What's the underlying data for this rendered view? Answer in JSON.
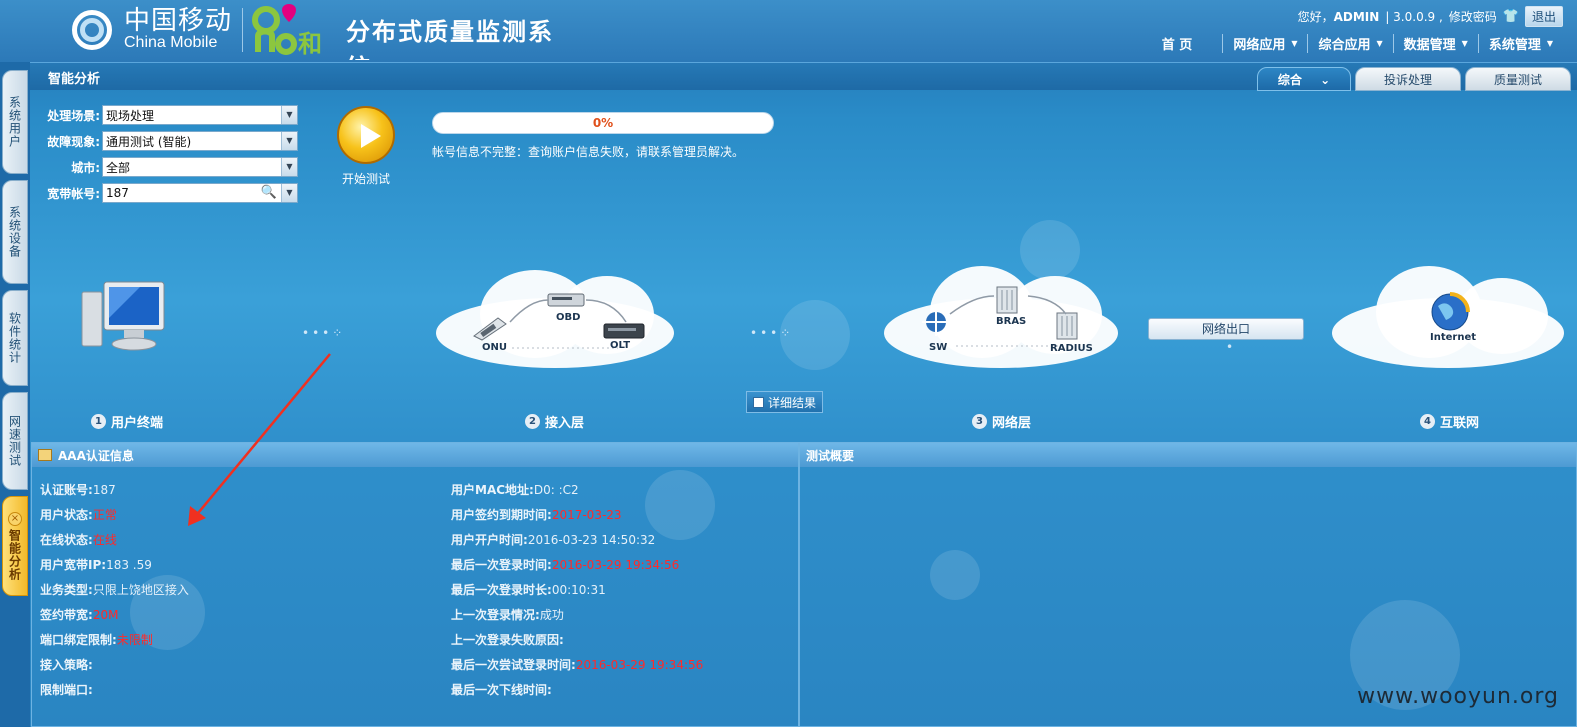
{
  "header": {
    "logo_cn": "中国移动",
    "logo_en": "China Mobile",
    "system_title": "分布式质量监测系统",
    "greeting": "您好，",
    "user": "ADMIN",
    "version": "| 3.0.0.9 ,",
    "change_password": "修改密码",
    "logout": "退出",
    "nav": [
      {
        "label": "首 页",
        "has_menu": false
      },
      {
        "label": "网络应用",
        "has_menu": true
      },
      {
        "label": "综合应用",
        "has_menu": true
      },
      {
        "label": "数据管理",
        "has_menu": true
      },
      {
        "label": "系统管理",
        "has_menu": true
      }
    ]
  },
  "page_title": "智能分析",
  "tabs": [
    {
      "label": "综合",
      "active": true
    },
    {
      "label": "投诉处理",
      "active": false
    },
    {
      "label": "质量测试",
      "active": false
    }
  ],
  "side_tabs": [
    {
      "label": "系统用户",
      "active": false
    },
    {
      "label": "系统设备",
      "active": false
    },
    {
      "label": "软件统计",
      "active": false
    },
    {
      "label": "网速测试",
      "active": false
    },
    {
      "label": "智能分析",
      "active": true
    }
  ],
  "form": {
    "scene_label": "处理场景:",
    "scene_value": "现场处理",
    "fault_label": "故障现象:",
    "fault_value": "通用测试 (智能)",
    "city_label": "城市:",
    "city_value": "全部",
    "account_label": "宽带帐号:",
    "account_value": "187"
  },
  "start_button": "开始测试",
  "progress": {
    "percent": 0,
    "label": "0%"
  },
  "status_message": "帐号信息不完整：查询账户信息失败，请联系管理员解决。",
  "topology": {
    "devices": {
      "onu": "ONU",
      "obd": "OBD",
      "olt": "OLT",
      "sw": "SW",
      "bras": "BRAS",
      "radius": "RADIUS",
      "internet": "Internet"
    },
    "net_exit": "网络出口",
    "detail_button": "详细结果",
    "layers": [
      {
        "num": "1",
        "label": "用户终端"
      },
      {
        "num": "2",
        "label": "接入层"
      },
      {
        "num": "3",
        "label": "网络层"
      },
      {
        "num": "4",
        "label": "互联网"
      }
    ]
  },
  "aaa_panel": {
    "title": "AAA认证信息",
    "left": [
      {
        "k": "认证账号:",
        "v": "187",
        "red": false
      },
      {
        "k": "用户状态:",
        "v": "正常",
        "red": true
      },
      {
        "k": "在线状态:",
        "v": "在线",
        "red": true
      },
      {
        "k": "用户宽带IP:",
        "v": "183          .59",
        "red": false
      },
      {
        "k": "业务类型:",
        "v": "只限上饶地区接入",
        "red": false
      },
      {
        "k": "签约带宽:",
        "v": "20M",
        "red": true
      },
      {
        "k": "端口绑定限制:",
        "v": "未限制",
        "red": true
      },
      {
        "k": "接入策略:",
        "v": "",
        "red": false
      },
      {
        "k": "限制端口:",
        "v": "",
        "red": false
      }
    ],
    "right": [
      {
        "k": "用户MAC地址:",
        "v": "D0:       :C2",
        "red": false
      },
      {
        "k": "用户签约到期时间:",
        "v": "2017-03-23",
        "red": true
      },
      {
        "k": "用户开户时间:",
        "v": "2016-03-23 14:50:32",
        "red": false
      },
      {
        "k": "最后一次登录时间:",
        "v": "2016-03-29 19:34:56",
        "red": true
      },
      {
        "k": "最后一次登录时长:",
        "v": "00:10:31",
        "red": false
      },
      {
        "k": "上一次登录情况:",
        "v": "成功",
        "red": false
      },
      {
        "k": "上一次登录失败原因:",
        "v": "",
        "red": false
      },
      {
        "k": "最后一次尝试登录时间:",
        "v": "2016-03-29 19:34:56",
        "red": true
      },
      {
        "k": "最后一次下线时间:",
        "v": "",
        "red": false
      }
    ]
  },
  "summary_panel": {
    "title": "测试概要"
  },
  "watermark": "www.wooyun.org",
  "colors": {
    "accent": "#2a8cc8",
    "red": "#ff2a2a",
    "progress_text": "#e0501b"
  }
}
